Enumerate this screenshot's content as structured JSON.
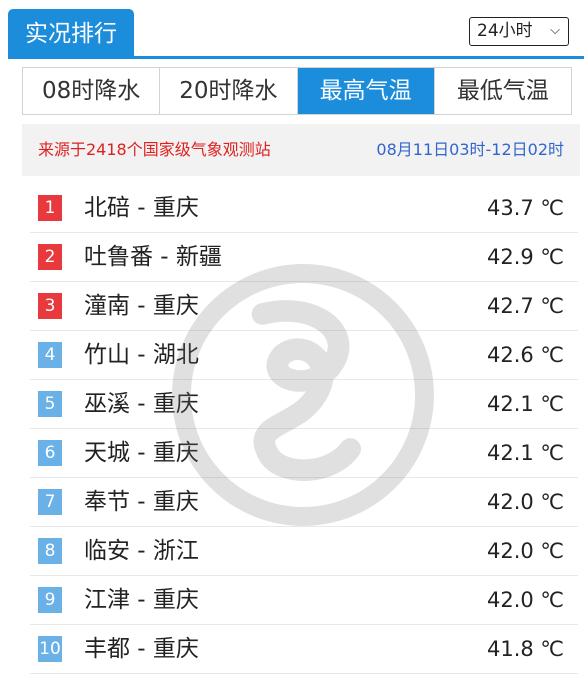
{
  "header": {
    "title": "实况排行",
    "range_select": {
      "value": "24小时"
    }
  },
  "tabs": [
    {
      "label": "08时降水",
      "active": false
    },
    {
      "label": "20时降水",
      "active": false
    },
    {
      "label": "最高气温",
      "active": true
    },
    {
      "label": "最低气温",
      "active": false
    }
  ],
  "info": {
    "source": "来源于2418个国家级气象观测站",
    "period": "08月11日03时-12日02时"
  },
  "ranking": [
    {
      "rank": "1",
      "station": "北碚 - 重庆",
      "temp": "43.7 ℃"
    },
    {
      "rank": "2",
      "station": "吐鲁番 - 新疆",
      "temp": "42.9 ℃"
    },
    {
      "rank": "3",
      "station": "潼南 - 重庆",
      "temp": "42.7 ℃"
    },
    {
      "rank": "4",
      "station": "竹山 - 湖北",
      "temp": "42.6 ℃"
    },
    {
      "rank": "5",
      "station": "巫溪 - 重庆",
      "temp": "42.1 ℃"
    },
    {
      "rank": "6",
      "station": "天城 - 重庆",
      "temp": "42.1 ℃"
    },
    {
      "rank": "7",
      "station": "奉节 - 重庆",
      "temp": "42.0 ℃"
    },
    {
      "rank": "8",
      "station": "临安 - 浙江",
      "temp": "42.0 ℃"
    },
    {
      "rank": "9",
      "station": "江津 - 重庆",
      "temp": "42.0 ℃"
    },
    {
      "rank": "10",
      "station": "丰都 - 重庆",
      "temp": "41.8 ℃"
    }
  ],
  "colors": {
    "accent": "#1c8ddb",
    "rank_top": "#e8393d",
    "rank_other": "#6ab1e8",
    "source_text": "#e02020",
    "period_text": "#3366cc"
  }
}
